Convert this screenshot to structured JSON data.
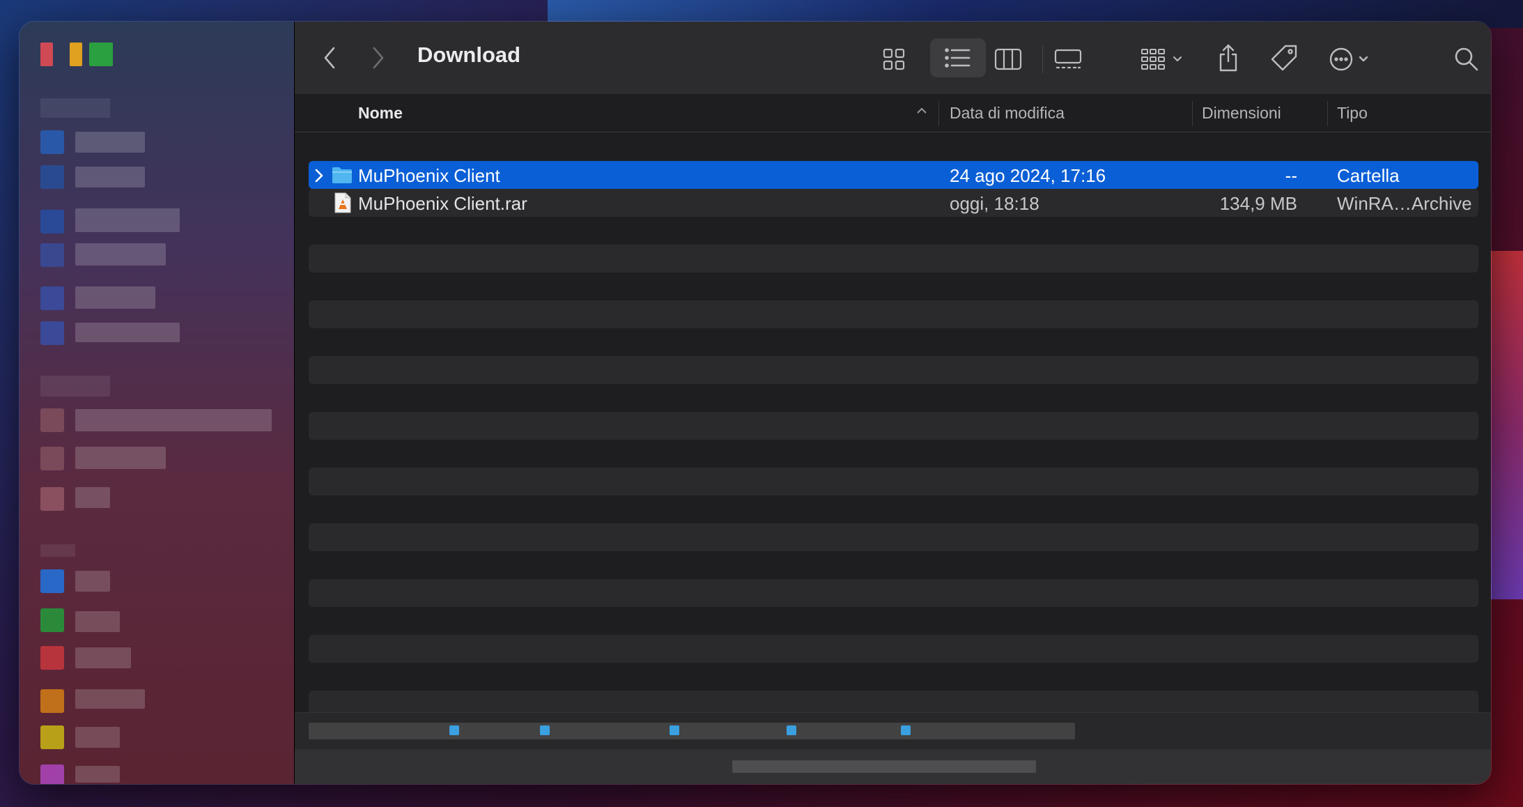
{
  "window": {
    "title": "Download"
  },
  "toolbar": {
    "back_icon": "chevron-left-icon",
    "forward_icon": "chevron-right-icon",
    "view_modes": [
      "icon-view",
      "list-view",
      "column-view",
      "gallery-view"
    ],
    "active_view": "list-view",
    "group_icon": "group-grid-icon",
    "share_icon": "share-icon",
    "tag_icon": "tag-icon",
    "more_icon": "ellipsis-circle-icon",
    "search_icon": "search-icon"
  },
  "columns": {
    "name": "Nome",
    "modified": "Data di modifica",
    "size": "Dimensioni",
    "kind": "Tipo"
  },
  "files": [
    {
      "name": "MuPhoenix Client",
      "modified": "24 ago 2024, 17:16",
      "size": "--",
      "kind": "Cartella",
      "icon": "folder-icon",
      "selected": true
    },
    {
      "name": "MuPhoenix Client.rar",
      "modified": "oggi, 18:18",
      "size": "134,9 MB",
      "kind": "WinRA…Archive",
      "icon": "archive-icon",
      "selected": false
    }
  ],
  "colors": {
    "selection": "#0a5fd6",
    "folder": "#4fb6f0",
    "toolbar": "#2c2c2e",
    "content_bg": "#1e1e20"
  }
}
